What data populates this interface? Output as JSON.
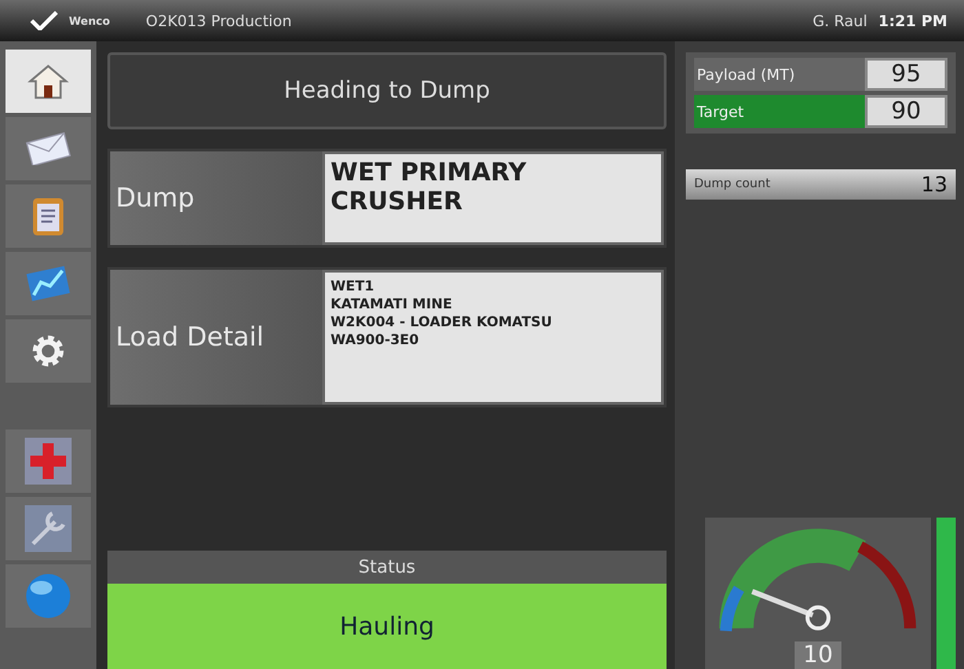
{
  "top_bar": {
    "logo": "Wenco",
    "title": "O2K013 Production",
    "user": "G. Raul",
    "time": "1:21 PM"
  },
  "sidebar": {
    "items": [
      {
        "kind": "home",
        "selected": true
      },
      {
        "kind": "mail",
        "selected": false
      },
      {
        "kind": "clipboard",
        "selected": false
      },
      {
        "kind": "chart",
        "selected": false
      },
      {
        "kind": "gear",
        "selected": false
      },
      {
        "kind": "cross",
        "selected": false
      },
      {
        "kind": "wrench",
        "selected": false
      },
      {
        "kind": "globe",
        "selected": false
      }
    ]
  },
  "heading": "Heading to Dump",
  "details": [
    {
      "label": "Dump",
      "kind": "large",
      "lines": [
        "WET PRIMARY",
        "CRUSHER"
      ]
    },
    {
      "label": "Load Detail",
      "kind": "small",
      "lines": [
        "WET1",
        "KATAMATI MINE",
        "W2K004 - LOADER KOMATSU",
        "WA900-3E0"
      ]
    }
  ],
  "metrics": [
    {
      "label": "Payload (MT)",
      "value": "95",
      "highlighted": false
    },
    {
      "label": "Target",
      "value": "90",
      "highlighted": true
    }
  ],
  "dump_count": {
    "label": "Dump count",
    "value": "13"
  },
  "status": {
    "title": "Status",
    "value": "Hauling"
  },
  "gauge": {
    "reading": "10"
  }
}
